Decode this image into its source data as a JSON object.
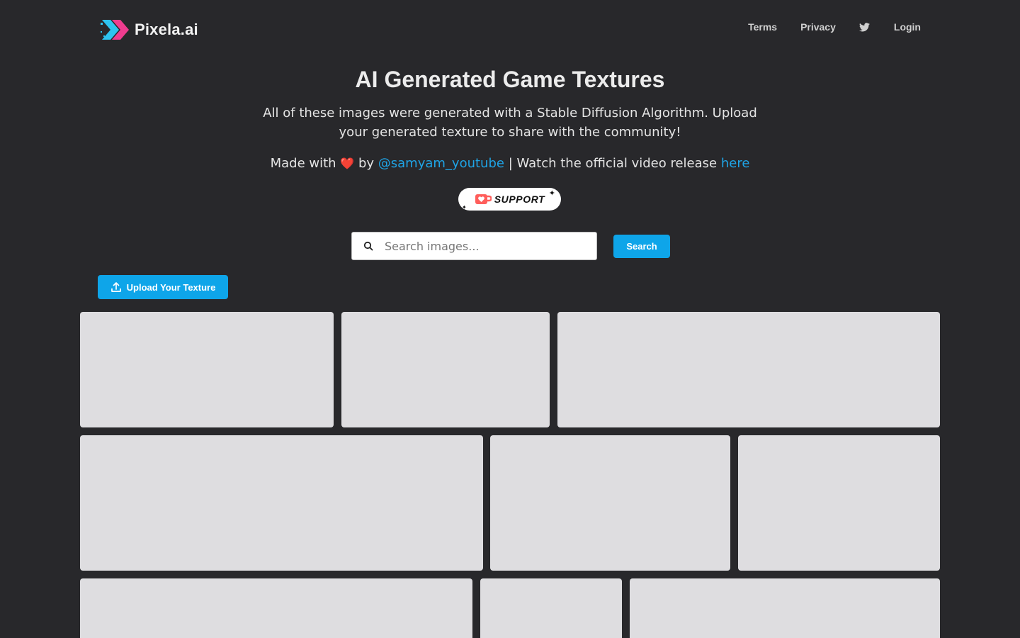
{
  "nav": {
    "brand": "Pixela.ai",
    "links": {
      "terms": "Terms",
      "privacy": "Privacy",
      "login": "Login"
    }
  },
  "hero": {
    "title": "AI Generated Game Textures",
    "subtitle": "All of these images were generated with a Stable Diffusion Algorithm. Upload your generated texture to share with the community!",
    "credit": {
      "prefix": "Made with",
      "heart": "❤️",
      "by": "by",
      "author_link": "@samyam_youtube",
      "separator": "| Watch the official video release",
      "video_link": "here"
    }
  },
  "support_button": {
    "label": "SUPPORT"
  },
  "search": {
    "placeholder": "Search images...",
    "value": "",
    "button_label": "Search"
  },
  "upload_button": {
    "label": "Upload Your Texture"
  },
  "colors": {
    "background": "#28282b",
    "accent": "#0ea5e9",
    "link": "#1fa4e6",
    "tile_placeholder": "#dedde0",
    "logo_blue": "#2ec4f0",
    "logo_pink": "#ef3c8f"
  },
  "gallery": {
    "rows": [
      {
        "tiles": [
          "texture",
          "texture",
          "texture"
        ]
      },
      {
        "tiles": [
          "texture",
          "texture",
          "texture"
        ]
      },
      {
        "tiles": [
          "texture",
          "texture",
          "texture"
        ]
      }
    ]
  }
}
